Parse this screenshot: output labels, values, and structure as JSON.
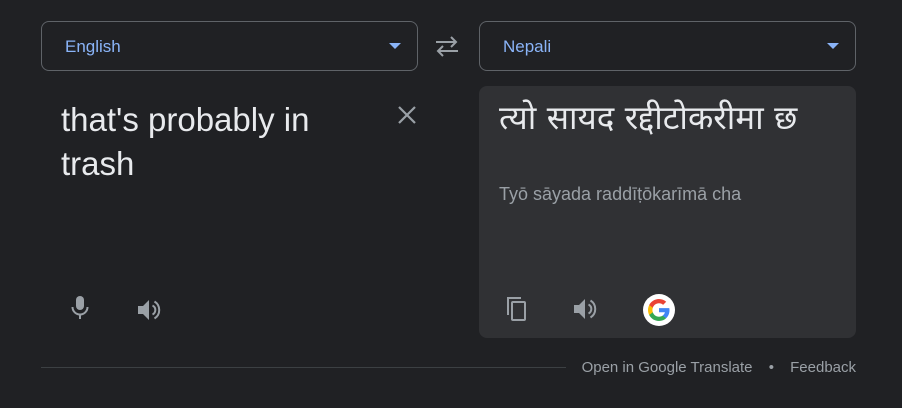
{
  "source_language": {
    "label": "English"
  },
  "target_language": {
    "label": "Nepali"
  },
  "source": {
    "text": "that's probably in trash"
  },
  "target": {
    "text": "त्यो सायद रद्दीटोकरीमा छ",
    "transliteration": "Tyō sāyada raddīṭōkarīmā cha"
  },
  "footer": {
    "open_link": "Open in Google Translate",
    "separator": "•",
    "feedback_link": "Feedback"
  },
  "icons": {
    "dropdown": "chevron-down-icon",
    "swap": "swap-icon",
    "clear": "close-icon",
    "microphone": "microphone-icon",
    "speaker": "speaker-icon",
    "copy": "copy-icon",
    "google": "google-logo-icon"
  },
  "colors": {
    "background": "#202124",
    "panel": "#303134",
    "accent": "#8ab4f8",
    "text": "#e8eaed",
    "muted": "#9aa0a6"
  }
}
